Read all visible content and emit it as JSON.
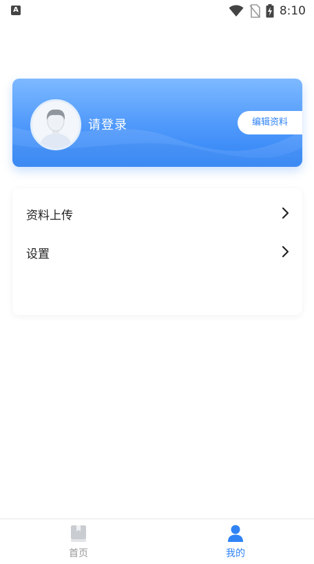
{
  "status_bar": {
    "left_icon_label": "A",
    "time": "8:10",
    "icons": [
      "wifi-icon",
      "no-sim-icon",
      "battery-charging-icon"
    ]
  },
  "profile": {
    "login_prompt": "请登录",
    "edit_button_label": "编辑资料",
    "avatar_icon": "default-avatar-icon"
  },
  "menu": {
    "items": [
      {
        "label": "资料上传",
        "icon": "chevron-right-icon"
      },
      {
        "label": "设置",
        "icon": "chevron-right-icon"
      }
    ]
  },
  "bottom_nav": {
    "items": [
      {
        "label": "首页",
        "icon": "book-icon",
        "active": false
      },
      {
        "label": "我的",
        "icon": "person-icon",
        "active": true
      }
    ]
  },
  "colors": {
    "accent": "#2f83f5",
    "inactive": "#999999",
    "card_gradient_top": "#7db9ff",
    "card_gradient_bottom": "#2f83f5"
  }
}
